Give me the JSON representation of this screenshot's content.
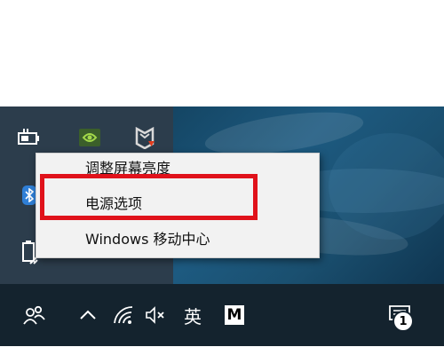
{
  "context_menu": {
    "items": [
      {
        "label": "调整屏幕亮度"
      },
      {
        "label": "电源选项"
      },
      {
        "label": "Windows 移动中心"
      }
    ],
    "highlighted_item": "电源选项"
  },
  "tray_overflow": {
    "icons": [
      "battery-icon",
      "nvidia-icon",
      "mcafee-icon",
      "bluetooth-icon",
      "usb-safely-remove-icon"
    ]
  },
  "taskbar": {
    "icons": [
      "people-icon",
      "chevron-up-icon",
      "wifi-icon",
      "volume-muted-icon",
      "ime-mode",
      "ime-m-icon",
      "notification-icon"
    ],
    "ime_mode_label": "英",
    "ime_icon_label": "M",
    "notification_count": "1"
  },
  "colors": {
    "highlight_border": "#e0121b",
    "taskbar_bg": "#14232e",
    "menu_bg": "#f2f2f2"
  }
}
